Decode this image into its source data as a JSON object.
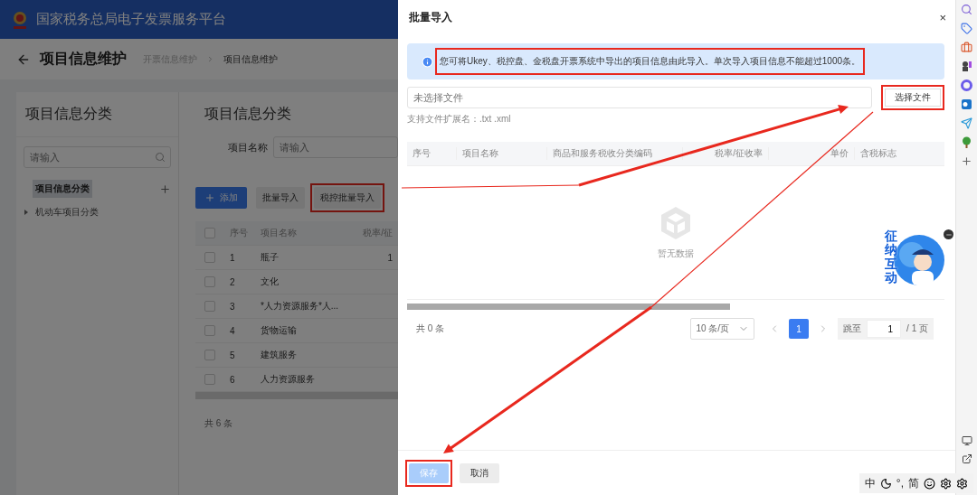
{
  "header": {
    "title": "国家税务总局电子发票服务平台"
  },
  "page": {
    "title": "项目信息维护",
    "breadcrumb": [
      {
        "label": "开票信息维护",
        "selected": false
      },
      {
        "label": "项目信息维护",
        "selected": true
      }
    ]
  },
  "category_panel": {
    "title": "项目信息分类",
    "search": {
      "placeholder": "请输入"
    },
    "tree": [
      {
        "label": "项目信息分类",
        "selected": true
      },
      {
        "label": "机动车项目分类",
        "selected": false,
        "expanded": false
      }
    ]
  },
  "list_panel": {
    "title": "项目信息分类",
    "filter": {
      "label": "项目名称",
      "placeholder": "请输入"
    },
    "buttons": [
      {
        "label": "添加",
        "kind": "primary",
        "highlighted": false
      },
      {
        "label": "批量导入",
        "kind": "default",
        "highlighted": false
      },
      {
        "label": "税控批量导入",
        "kind": "default",
        "highlighted": true
      }
    ],
    "table": {
      "all_checked": false,
      "columns": [
        "序号",
        "项目名称",
        "税率/征"
      ],
      "rows": [
        {
          "checked": false,
          "cells": [
            "1",
            "瓶子",
            "1"
          ]
        },
        {
          "checked": false,
          "cells": [
            "2",
            "文化",
            ""
          ]
        },
        {
          "checked": false,
          "cells": [
            "3",
            "*人力资源服务*人...",
            ""
          ]
        },
        {
          "checked": false,
          "cells": [
            "4",
            "货物运输",
            ""
          ]
        },
        {
          "checked": false,
          "cells": [
            "5",
            "建筑服务",
            ""
          ]
        },
        {
          "checked": false,
          "cells": [
            "6",
            "人力资源服务",
            ""
          ]
        }
      ]
    },
    "total": "共 6 条"
  },
  "drawer": {
    "title": "批量导入",
    "close": "×",
    "alert": {
      "text": "您可将Ukey、税控盘、金税盘开票系统中导出的项目信息由此导入。单次导入项目信息不能超过1000条。",
      "highlighted": true
    },
    "file": {
      "placeholder": "未选择文件",
      "button": "选择文件",
      "highlighted": true,
      "hint": "支持文件扩展名：.txt .xml"
    },
    "table": {
      "columns": [
        "序号",
        "项目名称",
        "商品和服务税收分类编码",
        "税率/征收率",
        "单价",
        "含税标志"
      ],
      "empty": "暂无数据"
    },
    "pagination": {
      "total": "共 0 条",
      "page_size": "10 条/页",
      "pages": [
        {
          "label": "1",
          "selected": true
        }
      ],
      "jump_label": "跳至",
      "jump_value": "1",
      "page_count": "/ 1 页"
    },
    "footer": [
      {
        "label": "保存",
        "kind": "primary",
        "disabled": true,
        "highlighted": true
      },
      {
        "label": "取消",
        "kind": "default",
        "disabled": false,
        "highlighted": false
      }
    ]
  },
  "mascot": {
    "label": "征纳互动"
  },
  "ime_bar": {
    "items": [
      {
        "kind": "text",
        "label": "中"
      },
      {
        "kind": "moon"
      },
      {
        "kind": "text",
        "label": "°,"
      },
      {
        "kind": "text",
        "label": "简"
      },
      {
        "kind": "smile"
      },
      {
        "kind": "gear"
      },
      {
        "kind": "gear"
      }
    ]
  }
}
